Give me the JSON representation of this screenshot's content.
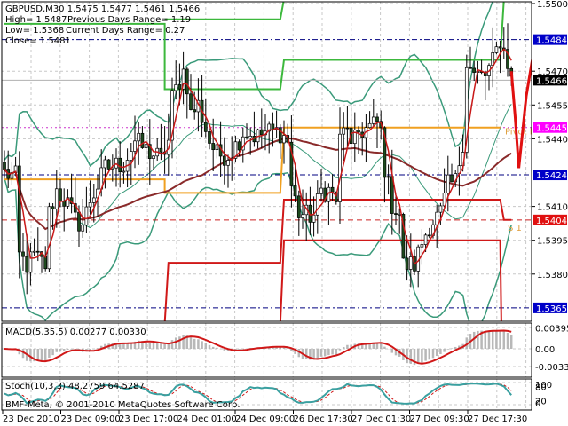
{
  "header": {
    "line1": "GBPUSD,M30  1.5475 1.5477 1.5461 1.5466",
    "high": "High= 1.5487",
    "prev_range": "Previous Days Range= 1.19",
    "low": "Low= 1.5368",
    "cur_range": "Current Days Range= 0.27",
    "close": "Close= 1.5481"
  },
  "price_axis": {
    "ticks": [
      "1.5500",
      "1.5470",
      "1.5455",
      "1.5440",
      "1.5410",
      "1.5395",
      "1.5380"
    ],
    "tick_values": [
      1.55,
      1.547,
      1.5455,
      1.544,
      1.541,
      1.5395,
      1.538
    ]
  },
  "levels": [
    {
      "label": "1.5484",
      "value": 1.5484,
      "color": "#0000c8",
      "line": "#000080",
      "style": "dashdot"
    },
    {
      "label": "1.5466",
      "value": 1.5466,
      "color": "#000000",
      "line": "#b0b0b0",
      "style": "solid"
    },
    {
      "label": "1.5445",
      "value": 1.5445,
      "color": "#ff00ff",
      "line": "#cc33cc",
      "style": "dot"
    },
    {
      "label": "1.5424",
      "value": 1.5424,
      "color": "#0000c8",
      "line": "#000080",
      "style": "dashdot"
    },
    {
      "label": "1.5404",
      "value": 1.5404,
      "color": "#e01010",
      "line": "#cc2020",
      "style": "dash"
    },
    {
      "label": "1.5365",
      "value": 1.5365,
      "color": "#0000c8",
      "line": "#000080",
      "style": "dashdot"
    }
  ],
  "pivot_labels": {
    "pivot": "Pivot Point",
    "s1": "S 1"
  },
  "macd": {
    "title": "MACD(5,35,5) 0.00277 0.00330",
    "ticks": [
      "0.00395",
      "0.00",
      "-0.0033"
    ],
    "tick_values": [
      0.00395,
      0,
      -0.0033
    ]
  },
  "stoch": {
    "title": "Stoch(10,3,3) 48.2759 64.5287",
    "ticks": [
      "100",
      "80",
      "20",
      "0"
    ],
    "tick_values": [
      100,
      80,
      20,
      0
    ]
  },
  "copyright": "BMF-Meta, © 2001-2010 MetaQuotes Software Corp.",
  "time_axis": [
    "23 Dec 2010",
    "23 Dec 09:00",
    "23 Dec 17:00",
    "24 Dec 01:00",
    "24 Dec 09:00",
    "26 Dec 17:30",
    "27 Dec 01:30",
    "27 Dec 09:30",
    "27 Dec 17:30"
  ],
  "chart_data": {
    "type": "candlestick",
    "symbol": "GBPUSD",
    "timeframe": "M30",
    "ylim": [
      1.5358,
      1.55
    ],
    "bars": 137,
    "close_keypoints": [
      [
        0,
        1.5425
      ],
      [
        3,
        1.5423
      ],
      [
        4,
        1.5388
      ],
      [
        6,
        1.5384
      ],
      [
        8,
        1.5388
      ],
      [
        11,
        1.5384
      ],
      [
        12,
        1.5407
      ],
      [
        14,
        1.5417
      ],
      [
        17,
        1.5411
      ],
      [
        19,
        1.5404
      ],
      [
        21,
        1.5402
      ],
      [
        23,
        1.5413
      ],
      [
        25,
        1.5419
      ],
      [
        27,
        1.5427
      ],
      [
        32,
        1.5429
      ],
      [
        35,
        1.5439
      ],
      [
        38,
        1.5435
      ],
      [
        42,
        1.5431
      ],
      [
        44,
        1.5439
      ],
      [
        45,
        1.5458
      ],
      [
        48,
        1.547
      ],
      [
        49,
        1.5464
      ],
      [
        50,
        1.5451
      ],
      [
        52,
        1.5455
      ],
      [
        55,
        1.5439
      ],
      [
        57,
        1.5433
      ],
      [
        60,
        1.5433
      ],
      [
        62,
        1.5437
      ],
      [
        64,
        1.5443
      ],
      [
        68,
        1.5441
      ],
      [
        70,
        1.5443
      ],
      [
        74,
        1.5443
      ],
      [
        76,
        1.5439
      ],
      [
        77,
        1.5419
      ],
      [
        79,
        1.5407
      ],
      [
        81,
        1.5406
      ],
      [
        83,
        1.5406
      ],
      [
        85,
        1.5417
      ],
      [
        87,
        1.5417
      ],
      [
        89,
        1.5413
      ],
      [
        90,
        1.5439
      ],
      [
        92,
        1.5447
      ],
      [
        93,
        1.5435
      ],
      [
        95,
        1.5443
      ],
      [
        98,
        1.5445
      ],
      [
        100,
        1.5447
      ],
      [
        101,
        1.5443
      ],
      [
        102,
        1.5427
      ],
      [
        104,
        1.5411
      ],
      [
        106,
        1.5407
      ],
      [
        107,
        1.5384
      ],
      [
        110,
        1.5384
      ],
      [
        112,
        1.5394
      ],
      [
        114,
        1.5402
      ],
      [
        117,
        1.5407
      ],
      [
        119,
        1.5419
      ],
      [
        121,
        1.5421
      ],
      [
        123,
        1.5439
      ],
      [
        124,
        1.5474
      ],
      [
        126,
        1.5468
      ],
      [
        129,
        1.5468
      ],
      [
        131,
        1.5474
      ],
      [
        133,
        1.5484
      ],
      [
        135,
        1.5474
      ],
      [
        136,
        1.5466
      ]
    ],
    "pivot_lines": {
      "r_upper": [
        [
          0,
          1.5491
        ],
        [
          43,
          1.5491
        ],
        [
          43,
          1.5462
        ],
        [
          74,
          1.5462
        ],
        [
          75,
          1.5475
        ],
        [
          133,
          1.5475
        ],
        [
          134,
          1.5502
        ]
      ],
      "r_top": [
        [
          43,
          1.5493
        ],
        [
          74,
          1.5493
        ],
        [
          75,
          1.5502
        ]
      ],
      "pivot": [
        [
          0,
          1.5422
        ],
        [
          43,
          1.5422
        ],
        [
          43,
          1.5416
        ],
        [
          74,
          1.5416
        ],
        [
          75,
          1.5445
        ],
        [
          133,
          1.5445
        ]
      ],
      "s1": [
        [
          43,
          1.5358
        ],
        [
          44,
          1.5385
        ],
        [
          74,
          1.5385
        ],
        [
          75,
          1.5413
        ],
        [
          133,
          1.5413
        ],
        [
          134,
          1.5404
        ],
        [
          136,
          1.5404
        ]
      ],
      "s2": [
        [
          74,
          1.5358
        ],
        [
          75,
          1.5395
        ],
        [
          133,
          1.5395
        ],
        [
          133.3,
          1.5358
        ]
      ]
    },
    "projection": [
      [
        136,
        1.547
      ],
      [
        137,
        1.545
      ],
      [
        138,
        1.5427
      ],
      [
        140,
        1.5459
      ],
      [
        141.5,
        1.5474
      ],
      [
        143,
        1.5486
      ],
      [
        144,
        1.5472
      ]
    ]
  }
}
